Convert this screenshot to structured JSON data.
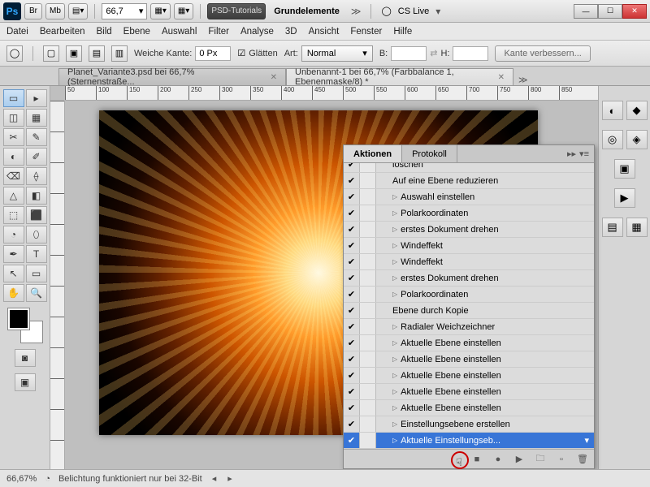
{
  "titlebar": {
    "zoom": "66,7",
    "psd_tutorials": "PSD-Tutorials",
    "grundelemente": "Grundelemente",
    "cslive": "CS Live"
  },
  "menu": [
    "Datei",
    "Bearbeiten",
    "Bild",
    "Ebene",
    "Auswahl",
    "Filter",
    "Analyse",
    "3D",
    "Ansicht",
    "Fenster",
    "Hilfe"
  ],
  "options": {
    "weiche_kante_lbl": "Weiche Kante:",
    "weiche_kante_val": "0 Px",
    "glaetten_lbl": "Glätten",
    "art_lbl": "Art:",
    "art_val": "Normal",
    "b_lbl": "B:",
    "h_lbl": "H:",
    "kante_btn": "Kante verbessern..."
  },
  "tabs": [
    "Planet_Variante3.psd bei 66,7% (Sternenstraße...",
    "Unbenannt-1 bei 66,7% (Farbbalance 1, Ebenenmaske/8) *"
  ],
  "ruler_h": [
    "50",
    "100",
    "150",
    "200",
    "250",
    "300",
    "350",
    "400",
    "450",
    "500",
    "550",
    "600",
    "650",
    "700",
    "750",
    "800",
    "850"
  ],
  "statusbar": {
    "zoom": "66,67%",
    "msg": "Belichtung funktioniert nur bei 32-Bit"
  },
  "panel": {
    "tab_aktionen": "Aktionen",
    "tab_protokoll": "Protokoll",
    "rows": [
      {
        "chk": true,
        "exp": false,
        "label": "löschen"
      },
      {
        "chk": true,
        "exp": false,
        "label": "Auf eine Ebene reduzieren"
      },
      {
        "chk": true,
        "exp": true,
        "label": "Auswahl einstellen"
      },
      {
        "chk": true,
        "exp": true,
        "label": "Polarkoordinaten"
      },
      {
        "chk": true,
        "exp": true,
        "label": "erstes Dokument drehen"
      },
      {
        "chk": true,
        "exp": true,
        "label": "Windeffekt"
      },
      {
        "chk": true,
        "exp": true,
        "label": "Windeffekt"
      },
      {
        "chk": true,
        "exp": true,
        "label": "erstes Dokument drehen"
      },
      {
        "chk": true,
        "exp": true,
        "label": "Polarkoordinaten"
      },
      {
        "chk": true,
        "exp": false,
        "label": "Ebene durch Kopie"
      },
      {
        "chk": true,
        "exp": true,
        "label": "Radialer Weichzeichner"
      },
      {
        "chk": true,
        "exp": true,
        "label": "Aktuelle Ebene einstellen"
      },
      {
        "chk": true,
        "exp": true,
        "label": "Aktuelle Ebene einstellen"
      },
      {
        "chk": true,
        "exp": true,
        "label": "Aktuelle Ebene einstellen"
      },
      {
        "chk": true,
        "exp": true,
        "label": "Aktuelle Ebene einstellen"
      },
      {
        "chk": true,
        "exp": true,
        "label": "Aktuelle Ebene einstellen"
      },
      {
        "chk": true,
        "exp": true,
        "label": "Einstellungsebene erstellen"
      },
      {
        "chk": true,
        "exp": true,
        "label": "Aktuelle Einstellungseb...",
        "sel": true
      }
    ]
  },
  "tools": [
    "▭",
    "▸",
    "◫",
    "▦",
    "✂",
    "✎",
    "◐",
    "✐",
    "⌫",
    "⟠",
    "△",
    "◧",
    "⬚",
    "⬛",
    "◔",
    "⬯",
    "✒",
    "T",
    "↖",
    "▭",
    "✋",
    "🔍"
  ]
}
